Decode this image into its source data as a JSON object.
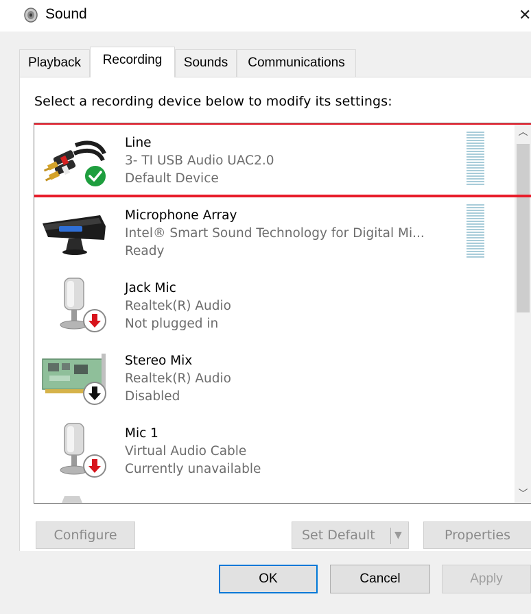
{
  "window": {
    "title": "Sound",
    "close_glyph": "✕",
    "icon": "speaker-icon"
  },
  "tabs": [
    {
      "label": "Playback",
      "active": false
    },
    {
      "label": "Recording",
      "active": true
    },
    {
      "label": "Sounds",
      "active": false
    },
    {
      "label": "Communications",
      "active": false
    }
  ],
  "instruction": "Select a recording device below to modify its settings:",
  "devices": [
    {
      "name": "Line",
      "description": "3- TI USB Audio UAC2.0",
      "status": "Default Device",
      "icon": "line-in-cable-icon",
      "badge": "default-check-icon",
      "selected": true
    },
    {
      "name": "Microphone Array",
      "description": "Intel® Smart Sound Technology for Digital Mi...",
      "status": "Ready",
      "icon": "microphone-array-icon",
      "badge": ""
    },
    {
      "name": "Jack Mic",
      "description": "Realtek(R) Audio",
      "status": "Not plugged in",
      "icon": "microphone-icon",
      "badge": "unplugged-down-arrow-icon"
    },
    {
      "name": "Stereo Mix",
      "description": "Realtek(R) Audio",
      "status": "Disabled",
      "icon": "sound-card-icon",
      "badge": "disabled-down-arrow-icon"
    },
    {
      "name": "Mic 1",
      "description": "Virtual Audio Cable",
      "status": "Currently unavailable",
      "icon": "microphone-icon",
      "badge": "unplugged-down-arrow-icon"
    }
  ],
  "panel_buttons": {
    "configure": "Configure",
    "set_default": "Set Default",
    "properties": "Properties"
  },
  "dialog_buttons": {
    "ok": "OK",
    "cancel": "Cancel",
    "apply": "Apply"
  },
  "colors": {
    "highlight": "#e81c2a",
    "check_badge": "#1e9e3e",
    "arrow_badge_red": "#d7141c",
    "focus_border": "#0078d7",
    "level_meter": "#a8ccd9"
  }
}
